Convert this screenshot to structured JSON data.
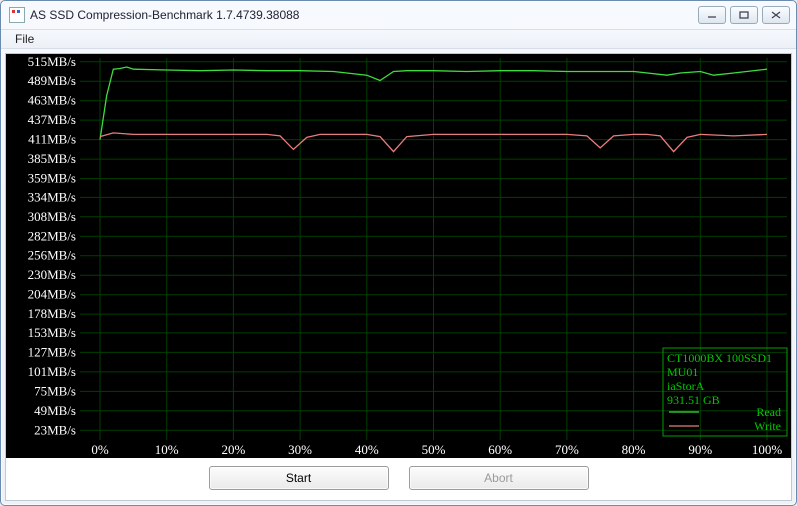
{
  "window": {
    "title": "AS SSD Compression-Benchmark 1.7.4739.38088"
  },
  "menubar": {
    "file": "File"
  },
  "buttons": {
    "start": "Start",
    "abort": "Abort"
  },
  "legend": {
    "device": "CT1000BX 100SSD1",
    "firmware": "MU01",
    "driver": "iaStorA",
    "capacity": "931.51 GB",
    "read": "Read",
    "write": "Write"
  },
  "chart_data": {
    "type": "line",
    "title": "",
    "xlabel": "",
    "ylabel": "",
    "y_unit": "MB/s",
    "x_unit": "%",
    "ylim": [
      0,
      520
    ],
    "xlim": [
      0,
      100
    ],
    "y_ticks": [
      23,
      49,
      75,
      101,
      127,
      153,
      178,
      204,
      230,
      256,
      282,
      308,
      334,
      359,
      385,
      411,
      437,
      463,
      489,
      515
    ],
    "y_tick_labels": [
      "23MB/s",
      "49MB/s",
      "75MB/s",
      "101MB/s",
      "127MB/s",
      "153MB/s",
      "178MB/s",
      "204MB/s",
      "230MB/s",
      "256MB/s",
      "282MB/s",
      "308MB/s",
      "334MB/s",
      "359MB/s",
      "385MB/s",
      "411MB/s",
      "437MB/s",
      "463MB/s",
      "489MB/s",
      "515MB/s"
    ],
    "x_ticks": [
      0,
      10,
      20,
      30,
      40,
      50,
      60,
      70,
      80,
      90,
      100
    ],
    "x_tick_labels": [
      "0%",
      "10%",
      "20%",
      "30%",
      "40%",
      "50%",
      "60%",
      "70%",
      "80%",
      "90%",
      "100%"
    ],
    "series": [
      {
        "name": "Read",
        "color": "#3fdc3f",
        "x": [
          0,
          1,
          2,
          3,
          4,
          5,
          10,
          15,
          20,
          25,
          30,
          35,
          40,
          42,
          44,
          46,
          50,
          55,
          60,
          65,
          70,
          75,
          80,
          85,
          87,
          90,
          92,
          95,
          100
        ],
        "y": [
          411,
          470,
          505,
          506,
          508,
          505,
          504,
          503,
          504,
          503,
          503,
          502,
          497,
          490,
          502,
          503,
          503,
          502,
          503,
          503,
          502,
          502,
          502,
          497,
          500,
          502,
          497,
          500,
          505
        ]
      },
      {
        "name": "Write",
        "color": "#e87c7c",
        "x": [
          0,
          2,
          5,
          10,
          15,
          20,
          25,
          27,
          29,
          31,
          33,
          35,
          40,
          42,
          44,
          46,
          50,
          55,
          60,
          65,
          70,
          73,
          75,
          77,
          80,
          82,
          84,
          86,
          88,
          90,
          95,
          100
        ],
        "y": [
          415,
          420,
          418,
          418,
          418,
          418,
          418,
          416,
          398,
          414,
          418,
          418,
          418,
          415,
          395,
          415,
          418,
          418,
          418,
          418,
          418,
          416,
          400,
          416,
          418,
          418,
          416,
          395,
          414,
          418,
          416,
          418
        ]
      }
    ]
  }
}
